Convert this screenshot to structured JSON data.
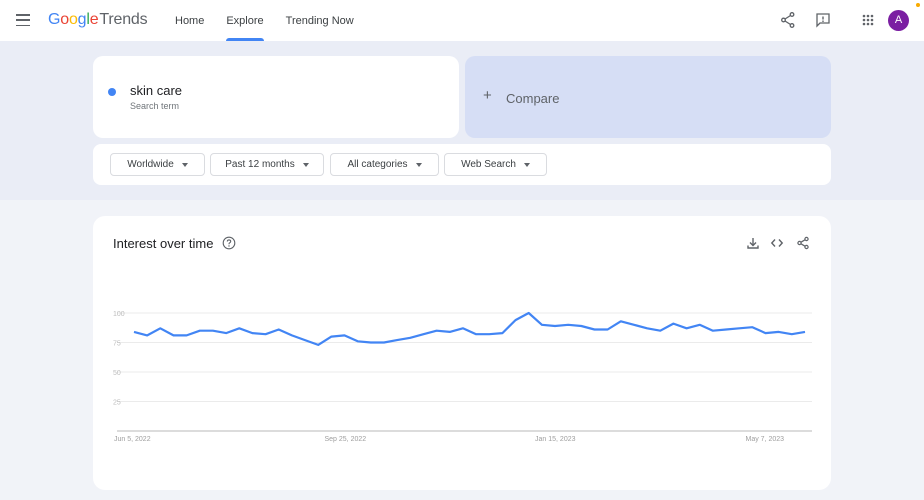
{
  "header": {
    "menu_icon": "hamburger-menu-icon",
    "logo": {
      "google": [
        "G",
        "o",
        "o",
        "g",
        "l",
        "e"
      ],
      "product": "Trends"
    },
    "nav": [
      {
        "label": "Home",
        "active": false
      },
      {
        "label": "Explore",
        "active": true
      },
      {
        "label": "Trending Now",
        "active": false
      }
    ],
    "icons": [
      "share-icon",
      "feedback-icon",
      "apps-grid-icon"
    ],
    "avatar_initial": "A",
    "accent_color": "#4285f4",
    "avatar_color": "#7b1fa2"
  },
  "search": {
    "term": "skin care",
    "term_sub": "Search term",
    "term_color": "#4285f4",
    "compare_label": "Compare",
    "compare_icon": "+"
  },
  "filters": [
    {
      "label": "Worldwide"
    },
    {
      "label": "Past 12 months"
    },
    {
      "label": "All categories"
    },
    {
      "label": "Web Search"
    }
  ],
  "chart_card": {
    "title": "Interest over time",
    "icons": [
      "download-icon",
      "embed-code-icon",
      "share-icon"
    ]
  },
  "chart_data": {
    "type": "line",
    "title": "Interest over time",
    "xlabel": "",
    "ylabel": "",
    "ylim": [
      0,
      100
    ],
    "yticks": [
      25,
      50,
      75,
      100
    ],
    "ytick_labels": [
      "25",
      "50",
      "75",
      "100"
    ],
    "xtick_labels": [
      "Jun 5, 2022",
      "Sep 25, 2022",
      "Jan 15, 2023",
      "May 7, 2023"
    ],
    "xtick_indices": [
      0,
      16,
      32,
      48
    ],
    "grid": true,
    "legend": "none",
    "series": [
      {
        "name": "skin care",
        "color": "#4285f4",
        "values": [
          84,
          81,
          87,
          81,
          81,
          85,
          85,
          83,
          87,
          83,
          82,
          86,
          81,
          77,
          73,
          80,
          81,
          76,
          75,
          75,
          77,
          79,
          82,
          85,
          84,
          87,
          82,
          82,
          83,
          94,
          100,
          90,
          89,
          90,
          89,
          86,
          86,
          93,
          90,
          87,
          85,
          91,
          87,
          90,
          85,
          86,
          87,
          88,
          83,
          84,
          82,
          84
        ]
      }
    ]
  }
}
